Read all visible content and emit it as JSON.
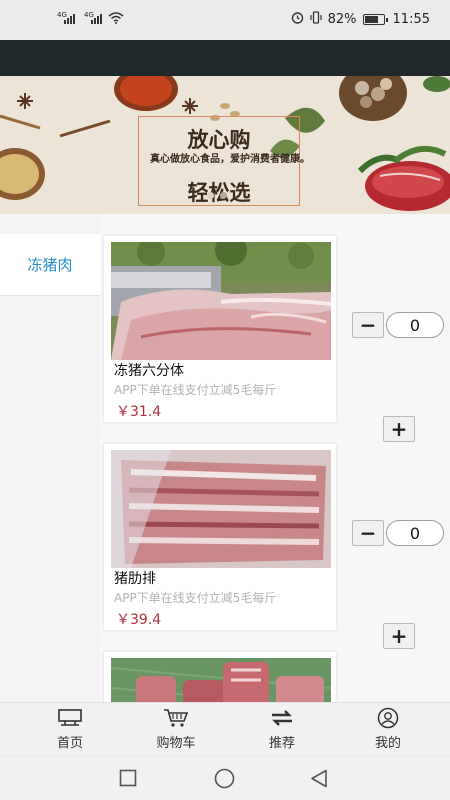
{
  "status_bar": {
    "signal1_label": "4G",
    "signal2_label": "4G",
    "battery_percent": "82%",
    "battery_level": 0.82,
    "time": "11:55",
    "icons": [
      "signal-icon",
      "signal-icon",
      "wifi-icon",
      "alarm-icon",
      "vibrate-icon",
      "battery-icon"
    ]
  },
  "banner": {
    "title": "放心购",
    "subtitle": "真心做放心食品，爱护消费者健康。",
    "title2": "轻松选",
    "slide_count": 2,
    "active_slide": 1
  },
  "categories": [
    {
      "label": "冻猪肉",
      "selected": true
    }
  ],
  "products": [
    {
      "name": "冻猪六分体",
      "desc": "APP下单在线支付立减5毛每斤",
      "price": "￥31.4",
      "qty": "0",
      "minus": "−",
      "plus": "+"
    },
    {
      "name": "猪肋排",
      "desc": "APP下单在线支付立减5毛每斤",
      "price": "￥39.4",
      "qty": "0",
      "minus": "−",
      "plus": "+"
    }
  ],
  "bottom_nav": [
    {
      "label": "首页",
      "icon": "home-icon"
    },
    {
      "label": "购物车",
      "icon": "cart-icon"
    },
    {
      "label": "推荐",
      "icon": "recommend-icon"
    },
    {
      "label": "我的",
      "icon": "profile-icon"
    }
  ],
  "system_nav": [
    "recents-icon",
    "home-circle-icon",
    "back-icon"
  ],
  "colors": {
    "header": "#21282b",
    "accent": "#2b8ccf",
    "price": "#b22e3a"
  }
}
